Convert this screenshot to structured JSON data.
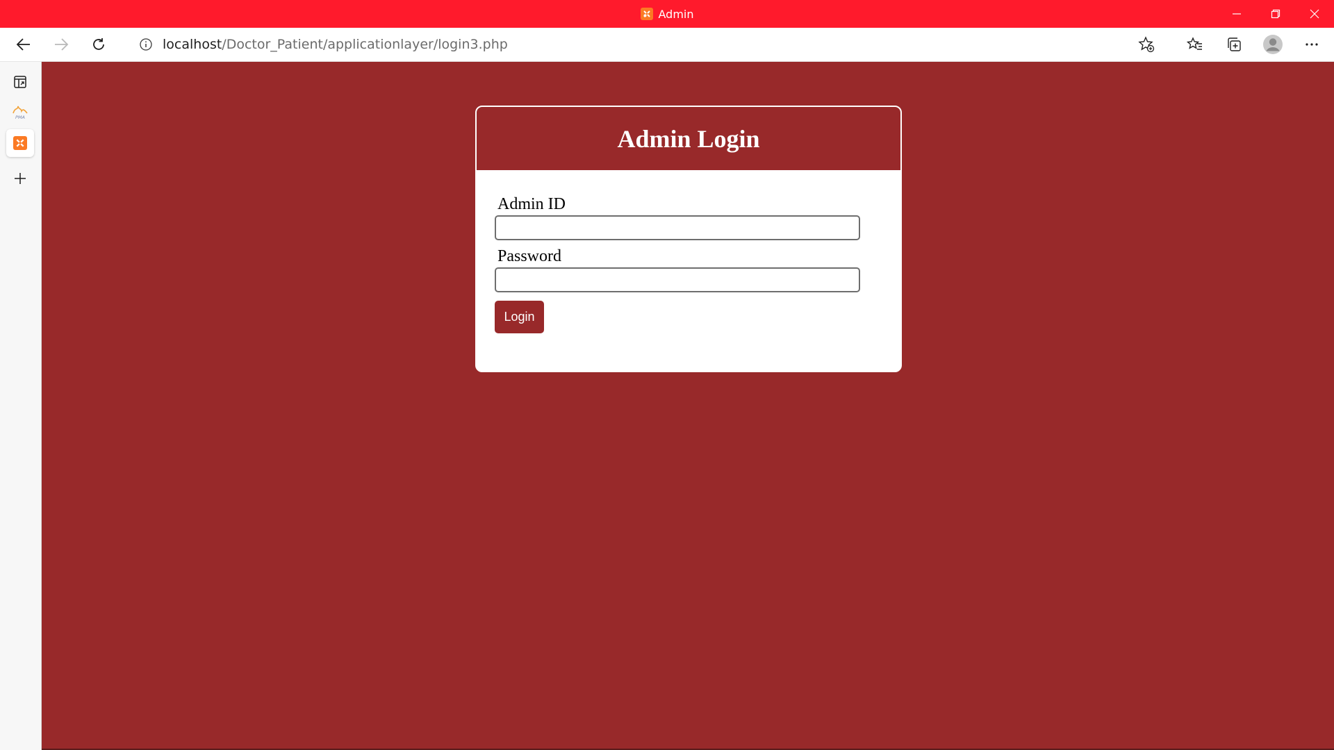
{
  "window": {
    "title": "Admin",
    "controls": [
      "minimize",
      "restore",
      "close"
    ]
  },
  "colors": {
    "titlebar": "#ff1a2c",
    "page_background": "#98292a",
    "card_header": "#98292a",
    "button": "#98292a",
    "xampp_orange": "#fb7a24"
  },
  "toolbar": {
    "url_host": "localhost",
    "url_path": "/Doctor_Patient/applicationlayer/login3.php",
    "icons": [
      "back-icon",
      "forward-icon",
      "refresh-icon",
      "info-icon",
      "add-favorite-icon",
      "favorites-icon",
      "collections-icon",
      "profile-icon",
      "more-icon"
    ]
  },
  "sidebar": {
    "items": [
      {
        "icon": "tab-actions-icon"
      },
      {
        "icon": "phpmyadmin-icon",
        "text": "PMA"
      },
      {
        "icon": "xampp-icon"
      },
      {
        "icon": "add-icon"
      }
    ]
  },
  "login": {
    "heading": "Admin Login",
    "admin_id_label": "Admin ID",
    "admin_id_value": "",
    "password_label": "Password",
    "password_value": "",
    "button_label": "Login"
  }
}
